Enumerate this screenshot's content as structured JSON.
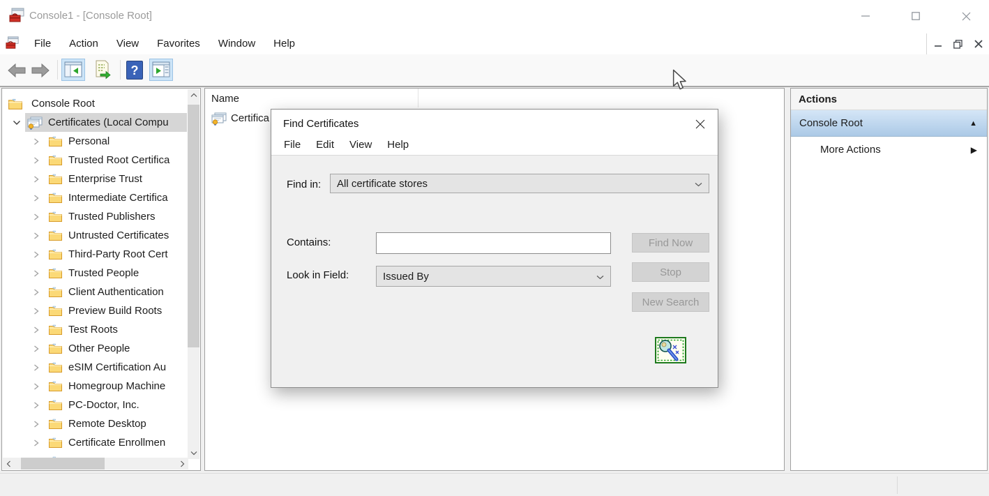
{
  "window": {
    "title": "Console1 - [Console Root]"
  },
  "menubar": {
    "items": [
      "File",
      "Action",
      "View",
      "Favorites",
      "Window",
      "Help"
    ]
  },
  "toolbar": {
    "icons": [
      "back-arrow",
      "forward-arrow",
      "console-tree-toggle",
      "export-list",
      "help",
      "action-pane-toggle"
    ]
  },
  "tree": {
    "root_label": "Console Root",
    "selected_label": "Certificates (Local Compu",
    "items": [
      "Personal",
      "Trusted Root Certifica",
      "Enterprise Trust",
      "Intermediate Certifica",
      "Trusted Publishers",
      "Untrusted Certificates",
      "Third-Party Root Cert",
      "Trusted People",
      "Client Authentication",
      "Preview Build Roots",
      "Test Roots",
      "Other People",
      "eSIM Certification Au",
      "Homegroup Machine",
      "PC-Doctor, Inc.",
      "Remote Desktop",
      "Certificate Enrollmen"
    ]
  },
  "list": {
    "column_header": "Name",
    "items": [
      "Certifica"
    ]
  },
  "dialog": {
    "title": "Find Certificates",
    "menu": [
      "File",
      "Edit",
      "View",
      "Help"
    ],
    "find_in_label": "Find in:",
    "find_in_value": "All certificate stores",
    "contains_label": "Contains:",
    "contains_value": "",
    "look_in_label": "Look in Field:",
    "look_in_value": "Issued By",
    "find_now_label": "Find Now",
    "stop_label": "Stop",
    "new_search_label": "New Search"
  },
  "actions_pane": {
    "header": "Actions",
    "group_title": "Console Root",
    "more_actions_label": "More Actions"
  },
  "colors": {
    "selection_inactive": "#d6d6d6",
    "actions_gradient_top": "#d5e6f7",
    "actions_gradient_bottom": "#abc9e6",
    "toolbar_toggle_bg": "#cce4f7",
    "title_text": "#9b9b9b"
  }
}
